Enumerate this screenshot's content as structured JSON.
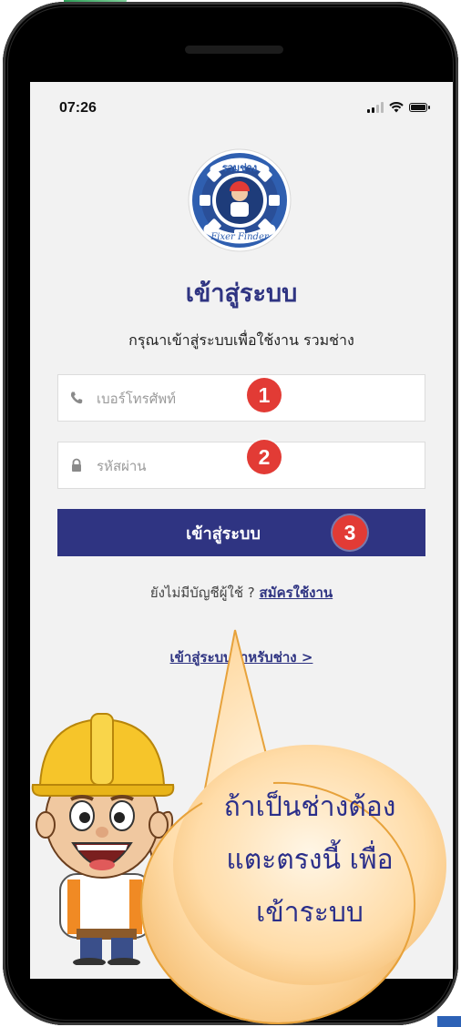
{
  "status_bar": {
    "time": "07:26"
  },
  "logo": {
    "arc_text": "รวมช่าง",
    "caption": "Fixer Finder"
  },
  "login": {
    "title": "เข้าสู่ระบบ",
    "subtitle": "กรุณาเข้าสู่ระบบเพื่อใช้งาน รวมช่าง",
    "phone_placeholder": "เบอร์โทรศัพท์",
    "password_placeholder": "รหัสผ่าน",
    "submit_label": "เข้าสู่ระบบ",
    "no_account_text": "ยังไม่มีบัญชีผู้ใช้ ?",
    "signup_link": "สมัครใช้งาน",
    "technician_link": "เข้าสู่ระบบสำหรับช่าง >"
  },
  "annotations": {
    "steps": [
      "1",
      "2",
      "3"
    ],
    "badge_color": "#e23b35",
    "callout_lines": [
      "ถ้าเป็นช่างต้อง",
      "แตะตรงนี้ เพื่อ",
      "เข้าระบบ"
    ]
  },
  "colors": {
    "brand": "#2f3482",
    "screen_bg": "#f2f2f2"
  }
}
